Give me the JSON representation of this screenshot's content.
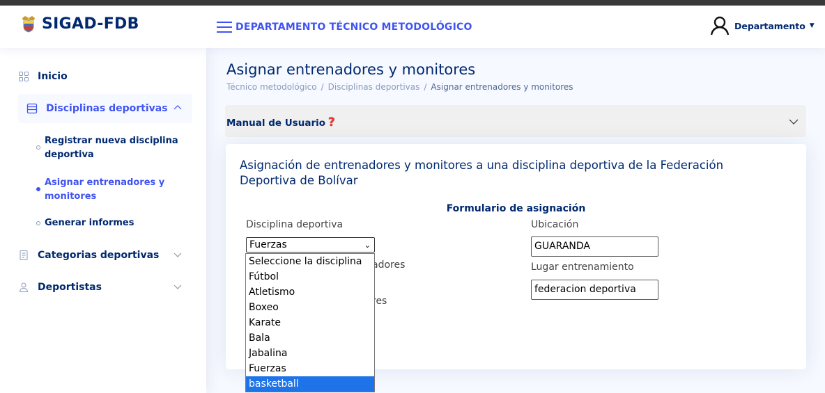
{
  "header": {
    "logo_text": "SIGAD-FDB",
    "title": "DEPARTAMENTO TÉCNICO METODOLÓGICO",
    "profile_label": "Departamento"
  },
  "sidebar": {
    "items": [
      {
        "label": "Inicio",
        "icon": "grid-icon"
      },
      {
        "label": "Disciplinas deportivas",
        "icon": "layout-icon"
      },
      {
        "label": "Categorias deportivas",
        "icon": "journal-icon"
      },
      {
        "label": "Deportistas",
        "icon": "person-icon"
      }
    ],
    "subitems": [
      {
        "label": "Registrar nueva disciplina deportiva"
      },
      {
        "label": "Asignar entrenadores y monitores"
      },
      {
        "label": "Generar informes"
      }
    ]
  },
  "page": {
    "title": "Asignar entrenadores y monitores",
    "breadcrumb": [
      "Técnico metodológico",
      "Disciplinas deportivas",
      "Asignar entrenadores y monitores"
    ],
    "manual_label": "Manual de Usuario",
    "manual_icon": "question-mark-icon"
  },
  "card": {
    "title": "Asignación de entrenadores y monitores a una disciplina deportiva de la Federación Deportiva de Bolívar",
    "form_title": "Formulario de asignación",
    "disciplina_label": "Disciplina deportiva",
    "disciplina_value": "Fuerzas",
    "ubicacion_label": "Ubicación",
    "ubicacion_value": "GUARANDA",
    "lugar_label": "Lugar entrenamiento",
    "lugar_value": "federacion deportiva",
    "hidden_entrenadores": "adores",
    "hidden_monitores": "res"
  },
  "dropdown": {
    "options": [
      "Seleccione la disciplina",
      "Fútbol",
      "Atletismo",
      "Boxeo",
      "Karate",
      "Bala",
      "Jabalina",
      "Fuerzas",
      "basketball"
    ],
    "highlighted": "basketball"
  },
  "colors": {
    "primary": "#4154f1",
    "navy": "#012970",
    "highlight": "#1e73e8"
  }
}
